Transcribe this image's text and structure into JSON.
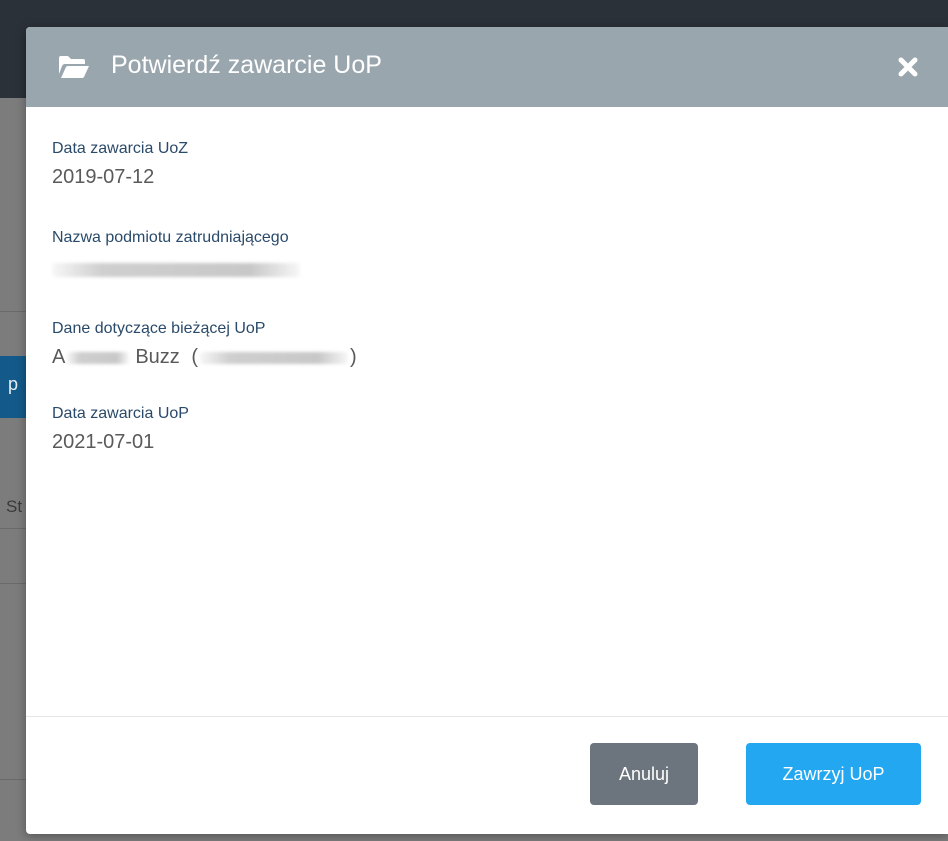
{
  "modal": {
    "title": "Potwierdź zawarcie UoP",
    "fields": [
      {
        "label": "Data zawarcia UoZ",
        "value": "2019-07-12"
      },
      {
        "label": "Nazwa podmiotu zatrudniającego",
        "value": ""
      },
      {
        "label": "Dane dotyczące bieżącej UoP",
        "value_prefix": "A",
        "value_mid": "Buzz",
        "value_open": "(",
        "value_close": ")"
      },
      {
        "label": "Data zawarcia UoP",
        "value": "2021-07-01"
      }
    ],
    "buttons": {
      "cancel_label": "Anuluj",
      "confirm_label": "Zawrzyj UoP"
    }
  },
  "background": {
    "partial_button_text": "p",
    "partial_text": "St"
  },
  "icons": {
    "header_icon": "folder-open-icon",
    "close_icon": "close-icon"
  },
  "colors": {
    "header_bg": "#9aa6ae",
    "cancel_bg": "#6c757d",
    "confirm_bg": "#22a7f0",
    "label_color": "#2a4a6a"
  }
}
